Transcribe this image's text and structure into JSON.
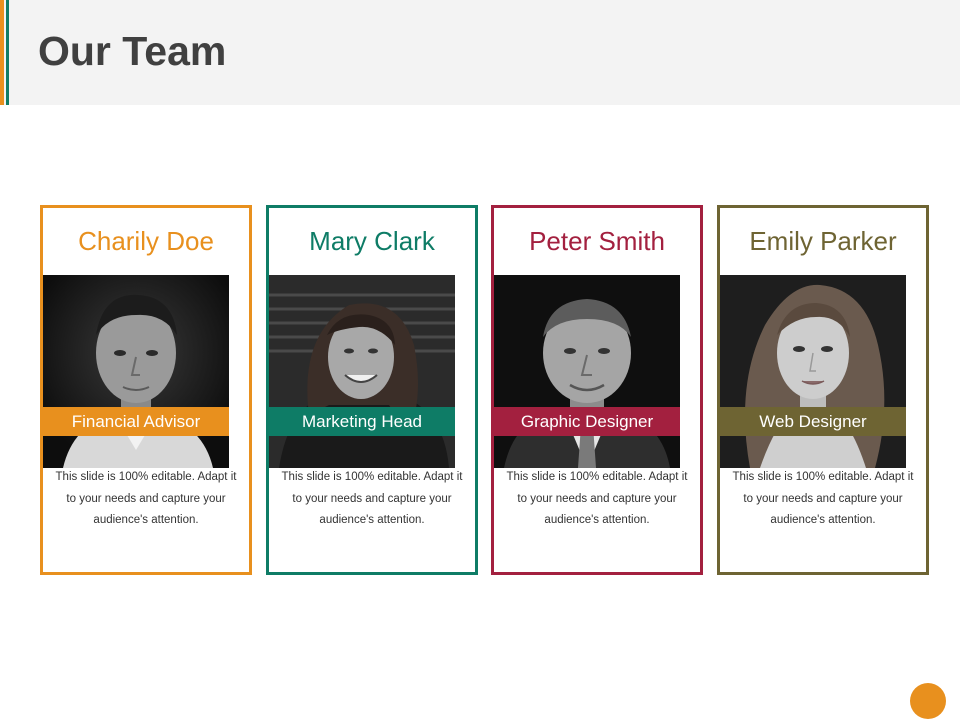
{
  "slide": {
    "title": "Our Team"
  },
  "team": [
    {
      "name": "Charily Doe",
      "role": "Financial Advisor",
      "description": "This slide is 100% editable. Adapt it to your needs and capture your audience's attention.",
      "accent": "#e8901e",
      "photo_icon": "portrait-young-man"
    },
    {
      "name": "Mary Clark",
      "role": "Marketing Head",
      "description": "This slide is 100% editable. Adapt it to your needs and capture your audience's attention.",
      "accent": "#0e7c66",
      "photo_icon": "portrait-smiling-woman"
    },
    {
      "name": "Peter Smith",
      "role": "Graphic Designer",
      "description": "This slide is 100% editable. Adapt it to your needs and capture your audience's attention.",
      "accent": "#a3203f",
      "photo_icon": "portrait-older-man"
    },
    {
      "name": "Emily Parker",
      "role": "Web Designer",
      "description": "This slide is 100% editable. Adapt it to your needs and capture your audience's attention.",
      "accent": "#6e6433",
      "photo_icon": "portrait-woman"
    }
  ],
  "colors": {
    "header_bg": "#f3f3f3",
    "title": "#404040",
    "orange": "#e8901e",
    "green": "#0e7c66"
  }
}
